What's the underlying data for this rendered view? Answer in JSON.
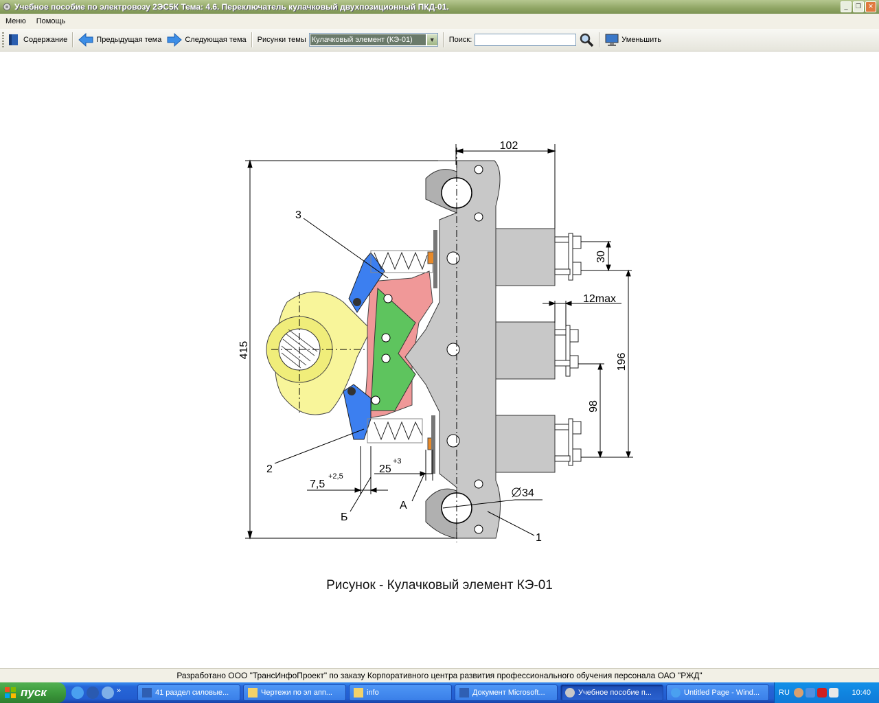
{
  "window": {
    "title": "Учебное пособие по электровозу 2ЭС5К Тема: 4.6. Переключатель кулачковый двухпозиционный ПКД-01."
  },
  "menu": {
    "items": [
      "Меню",
      "Помощь"
    ]
  },
  "toolbar": {
    "contents_label": "Содержание",
    "prev_label": "Предыдущая тема",
    "next_label": "Следующая тема",
    "pictures_label": "Рисунки темы",
    "pictures_selected": "Кулачковый элемент (КЭ-01)",
    "search_label": "Поиск:",
    "search_value": "",
    "shrink_label": "Уменьшить"
  },
  "drawing": {
    "labels": {
      "dim_102": "102",
      "dim_415": "415",
      "dim_30": "30",
      "dim_12max": "12max",
      "dim_196": "196",
      "dim_98": "98",
      "dim_25": "25",
      "dim_25_tol": "+3",
      "dim_7_5": "7,5",
      "dim_7_5_tol": "+2,5",
      "dim_d34": "34",
      "callout_1": "1",
      "callout_2": "2",
      "callout_3": "3",
      "callout_a": "А",
      "callout_b": "Б"
    },
    "colors": {
      "frame_gray": "#c8c8c8",
      "cam_yellow": "#f8f59a",
      "lever_blue": "#3c7ff0",
      "body_pink": "#f09898",
      "plate_green": "#5ec45e",
      "contact_orange": "#e88a2a"
    }
  },
  "caption": "Рисунок - Кулачковый элемент КЭ-01",
  "footer": "Разработано ООО \"ТрансИнфоПроект\" по заказу Корпоративного центра развития профессионального обучения персонала ОАО \"РЖД\"",
  "taskbar": {
    "start_label": "пуск",
    "tasks": [
      "41 раздел силовые...",
      "Чертежи по эл апп...",
      "info",
      "Документ Microsoft...",
      "Учебное пособие п...",
      "Untitled Page - Wind..."
    ],
    "language": "RU",
    "clock": "10:40"
  }
}
